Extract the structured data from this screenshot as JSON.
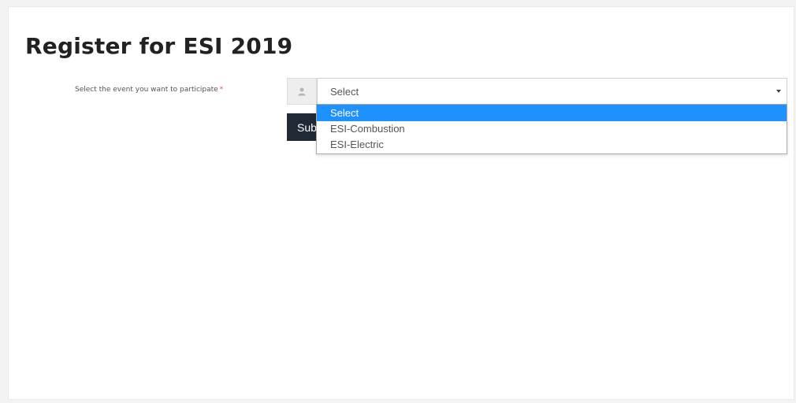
{
  "page": {
    "title": "Register for ESI 2019"
  },
  "form": {
    "event_label": "Select the event you want to participate",
    "required_marker": "*",
    "user_icon": "user-icon",
    "select_value": "Select",
    "options": [
      "Select",
      "ESI-Combustion",
      "ESI-Electric"
    ],
    "highlighted_option": "Select",
    "submit_label": "Sub"
  },
  "colors": {
    "submit_button": "#1f2a36",
    "highlight": "#1e90ff",
    "required": "#d9534f"
  }
}
